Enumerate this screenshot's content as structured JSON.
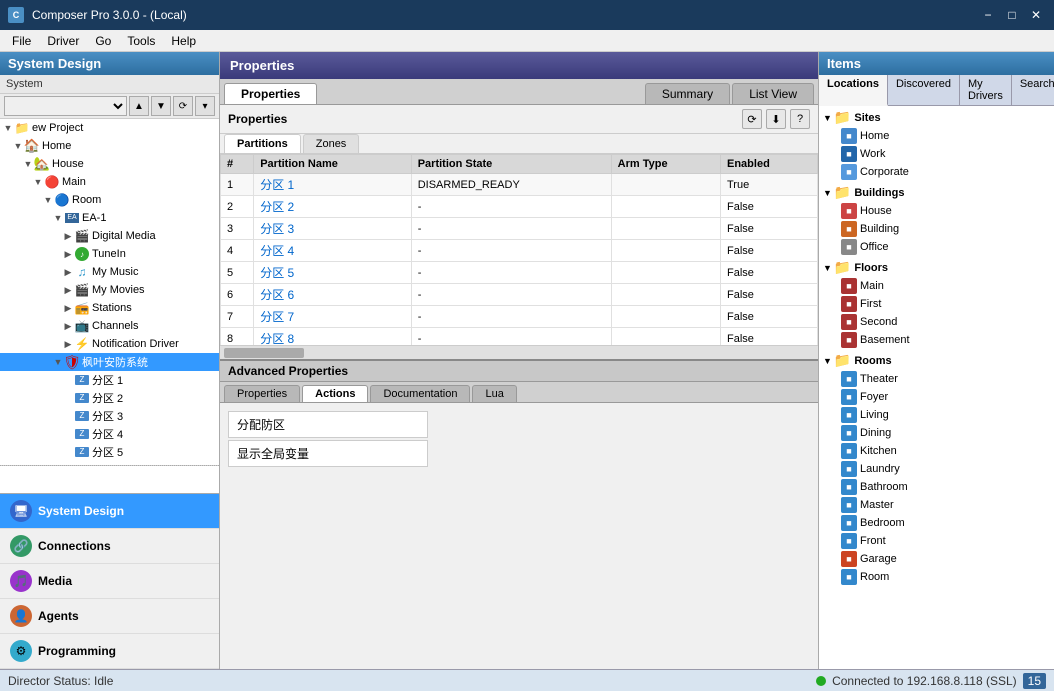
{
  "titlebar": {
    "icon_label": "C",
    "title": "Composer Pro 3.0.0 - (Local)",
    "minimize_label": "−",
    "maximize_label": "□",
    "close_label": "✕"
  },
  "menubar": {
    "items": [
      "File",
      "Driver",
      "Go",
      "Tools",
      "Help"
    ]
  },
  "left_panel": {
    "header": "System Design",
    "system_label": "System",
    "tree_items": [
      {
        "id": "ew-project",
        "label": "ew Project",
        "indent": 0,
        "type": "project",
        "expand": true
      },
      {
        "id": "home",
        "label": "Home",
        "indent": 1,
        "type": "home",
        "expand": true
      },
      {
        "id": "house",
        "label": "House",
        "indent": 2,
        "type": "house",
        "expand": true
      },
      {
        "id": "main",
        "label": "Main",
        "indent": 3,
        "type": "main",
        "expand": true
      },
      {
        "id": "room",
        "label": "Room",
        "indent": 4,
        "type": "room",
        "expand": true
      },
      {
        "id": "ea1",
        "label": "EA-1",
        "indent": 5,
        "type": "ea",
        "expand": true
      },
      {
        "id": "digital-media",
        "label": "Digital Media",
        "indent": 6,
        "type": "media"
      },
      {
        "id": "tunein",
        "label": "TuneIn",
        "indent": 6,
        "type": "tunein"
      },
      {
        "id": "my-music",
        "label": "My Music",
        "indent": 6,
        "type": "music"
      },
      {
        "id": "my-movies",
        "label": "My Movies",
        "indent": 6,
        "type": "movies"
      },
      {
        "id": "stations",
        "label": "Stations",
        "indent": 6,
        "type": "stations"
      },
      {
        "id": "channels",
        "label": "Channels",
        "indent": 6,
        "type": "channels"
      },
      {
        "id": "notif-driver",
        "label": "Notification Driver",
        "indent": 6,
        "type": "notification"
      },
      {
        "id": "alarm-system",
        "label": "枫叶安防系统",
        "indent": 5,
        "type": "alarm",
        "expand": true,
        "selected": true
      },
      {
        "id": "zone1",
        "label": "分区 1",
        "indent": 6,
        "type": "zone"
      },
      {
        "id": "zone2",
        "label": "分区 2",
        "indent": 6,
        "type": "zone"
      },
      {
        "id": "zone3",
        "label": "分区 3",
        "indent": 6,
        "type": "zone"
      },
      {
        "id": "zone4",
        "label": "分区 4",
        "indent": 6,
        "type": "zone"
      },
      {
        "id": "zone5-partial",
        "label": "分区 5",
        "indent": 6,
        "type": "zone"
      }
    ]
  },
  "bottom_nav": {
    "items": [
      {
        "id": "system-design",
        "label": "System Design",
        "icon": "🖥",
        "active": true
      },
      {
        "id": "connections",
        "label": "Connections",
        "icon": "🔗"
      },
      {
        "id": "media",
        "label": "Media",
        "icon": "🎵"
      },
      {
        "id": "agents",
        "label": "Agents",
        "icon": "👤"
      },
      {
        "id": "programming",
        "label": "Programming",
        "icon": "⚙"
      }
    ]
  },
  "center_panel": {
    "header": "Properties",
    "main_tabs": [
      {
        "id": "properties",
        "label": "Properties",
        "active": true
      },
      {
        "id": "summary",
        "label": "Summary"
      },
      {
        "id": "list-view",
        "label": "List View"
      }
    ],
    "sub_header": "Properties",
    "inner_tabs": [
      {
        "id": "partitions",
        "label": "Partitions",
        "active": true
      },
      {
        "id": "zones",
        "label": "Zones"
      }
    ],
    "toolbar_icons": [
      "⟳",
      "⬇",
      "?"
    ],
    "table": {
      "columns": [
        "#",
        "Partition Name",
        "Partition State",
        "Arm Type",
        "Enabled"
      ],
      "rows": [
        {
          "num": "1",
          "name": "分区 1",
          "state": "DISARMED_READY",
          "arm_type": "",
          "enabled": "True"
        },
        {
          "num": "2",
          "name": "分区 2",
          "state": "-",
          "arm_type": "",
          "enabled": "False"
        },
        {
          "num": "3",
          "name": "分区 3",
          "state": "-",
          "arm_type": "",
          "enabled": "False"
        },
        {
          "num": "4",
          "name": "分区 4",
          "state": "-",
          "arm_type": "",
          "enabled": "False"
        },
        {
          "num": "5",
          "name": "分区 5",
          "state": "-",
          "arm_type": "",
          "enabled": "False"
        },
        {
          "num": "6",
          "name": "分区 6",
          "state": "-",
          "arm_type": "",
          "enabled": "False"
        },
        {
          "num": "7",
          "name": "分区 7",
          "state": "-",
          "arm_type": "",
          "enabled": "False"
        },
        {
          "num": "8",
          "name": "分区 8",
          "state": "-",
          "arm_type": "",
          "enabled": "False"
        }
      ]
    },
    "advanced": {
      "header": "Advanced Properties",
      "tabs": [
        {
          "id": "properties",
          "label": "Properties"
        },
        {
          "id": "actions",
          "label": "Actions",
          "active": true
        },
        {
          "id": "documentation",
          "label": "Documentation"
        },
        {
          "id": "lua",
          "label": "Lua"
        }
      ],
      "actions": [
        "分配防区",
        "显示全局变量"
      ]
    }
  },
  "right_panel": {
    "header": "Items",
    "tabs": [
      {
        "id": "locations",
        "label": "Locations",
        "active": true
      },
      {
        "id": "discovered",
        "label": "Discovered"
      },
      {
        "id": "my-drivers",
        "label": "My Drivers"
      },
      {
        "id": "search",
        "label": "Search"
      }
    ],
    "tree": {
      "sections": [
        {
          "label": "Sites",
          "children": [
            {
              "label": "Home",
              "color": "color-home"
            },
            {
              "label": "Work",
              "color": "color-work"
            },
            {
              "label": "Corporate",
              "color": "color-corporate"
            }
          ]
        },
        {
          "label": "Buildings",
          "children": [
            {
              "label": "House",
              "color": "color-house"
            },
            {
              "label": "Building",
              "color": "color-building"
            },
            {
              "label": "Office",
              "color": "color-office"
            }
          ]
        },
        {
          "label": "Floors",
          "children": [
            {
              "label": "Main",
              "color": "color-floor"
            },
            {
              "label": "First",
              "color": "color-floor"
            },
            {
              "label": "Second",
              "color": "color-floor"
            },
            {
              "label": "Basement",
              "color": "color-floor"
            }
          ]
        },
        {
          "label": "Rooms",
          "children": [
            {
              "label": "Theater",
              "color": "color-room"
            },
            {
              "label": "Foyer",
              "color": "color-room"
            },
            {
              "label": "Living",
              "color": "color-room"
            },
            {
              "label": "Dining",
              "color": "color-room"
            },
            {
              "label": "Kitchen",
              "color": "color-room"
            },
            {
              "label": "Laundry",
              "color": "color-room"
            },
            {
              "label": "Bathroom",
              "color": "color-room"
            },
            {
              "label": "Master",
              "color": "color-room"
            },
            {
              "label": "Bedroom",
              "color": "color-room"
            },
            {
              "label": "Front",
              "color": "color-room"
            },
            {
              "label": "Garage",
              "color": "color-special"
            },
            {
              "label": "Room",
              "color": "color-room"
            }
          ]
        }
      ]
    }
  },
  "status_bar": {
    "director_status": "Director Status: Idle",
    "connection": "Connected to 192.168.8.118 (SSL)",
    "count": "15"
  }
}
